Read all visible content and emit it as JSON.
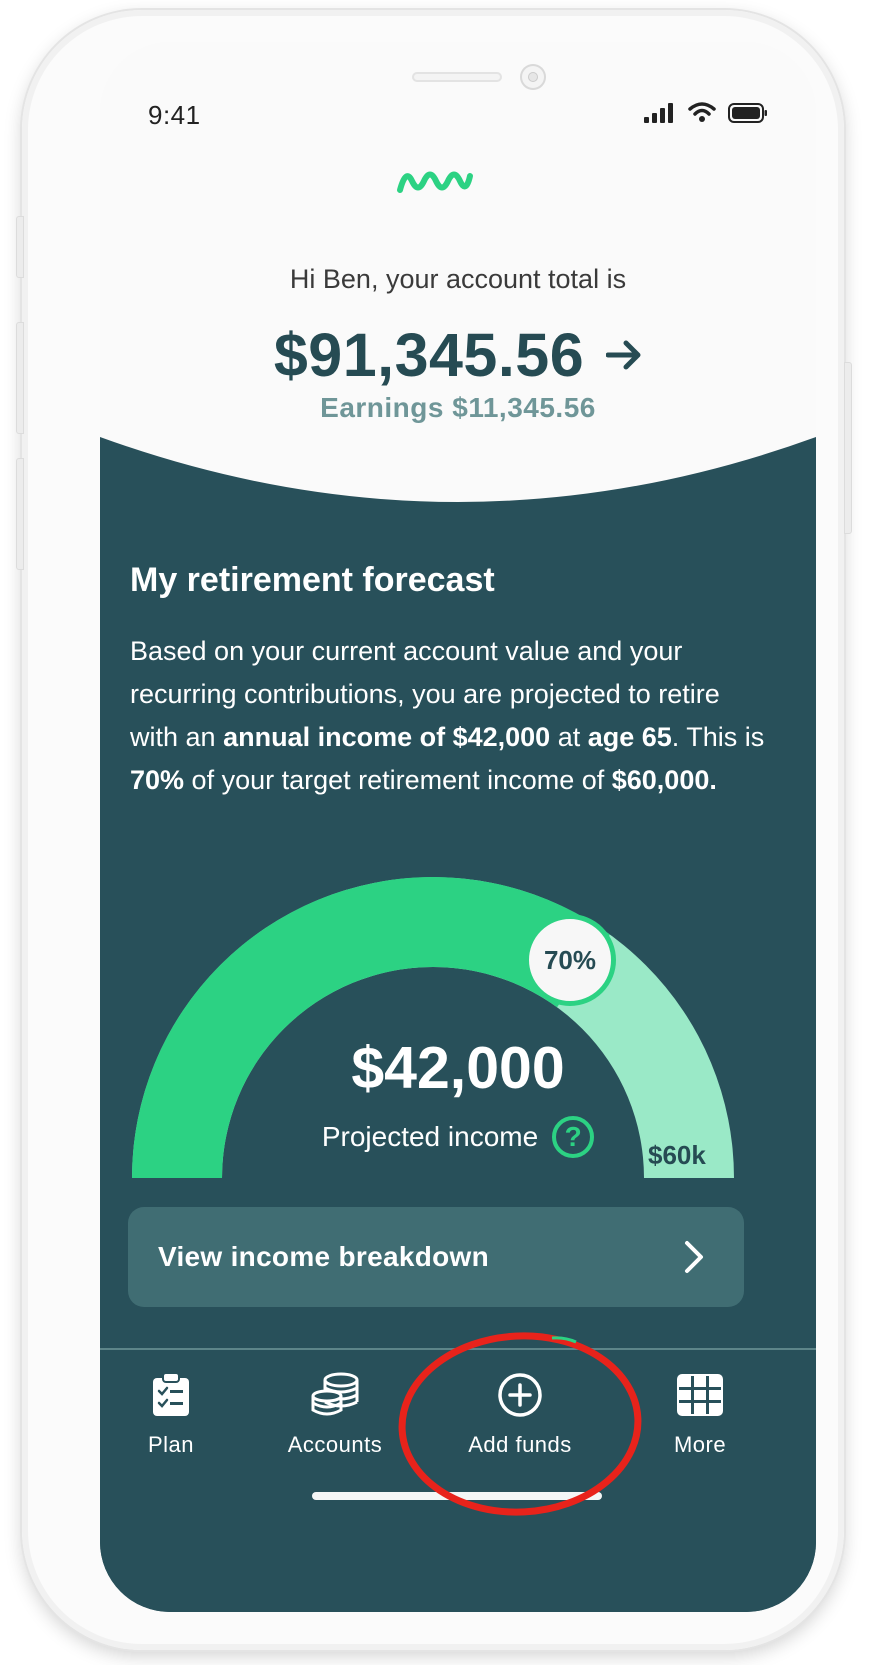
{
  "status": {
    "time": "9:41"
  },
  "header": {
    "greeting": "Hi Ben, your account total is",
    "total": "$91,345.56",
    "earnings": "Earnings $11,345.56"
  },
  "forecast": {
    "title": "My retirement forecast",
    "text": {
      "p1": "Based on your current account value and your recurring contributions, you are projected to retire with an ",
      "b1": "annual income of $42,000",
      "p2": " at ",
      "b2": "age 65",
      "p3": ". This is ",
      "b3": "70%",
      "p4": " of your target retirement income of ",
      "b4": "$60,000."
    },
    "gauge": {
      "percent_label": "70%",
      "progress_fraction": 0.7,
      "amount": "$42,000",
      "label": "Projected income",
      "help_symbol": "?",
      "target_label": "$60k"
    },
    "breakdown_label": "View income breakdown"
  },
  "tabs": [
    {
      "label": "Plan",
      "icon": "clipboard-check-icon"
    },
    {
      "label": "Accounts",
      "icon": "coins-stack-icon"
    },
    {
      "label": "Add funds",
      "icon": "plus-circle-icon"
    },
    {
      "label": "More",
      "icon": "grid-icon"
    }
  ],
  "colors": {
    "teal_dark": "#28505a",
    "accent_green": "#2cd283",
    "light_green": "#9ae9c7",
    "annotation_red": "#e8231b"
  }
}
